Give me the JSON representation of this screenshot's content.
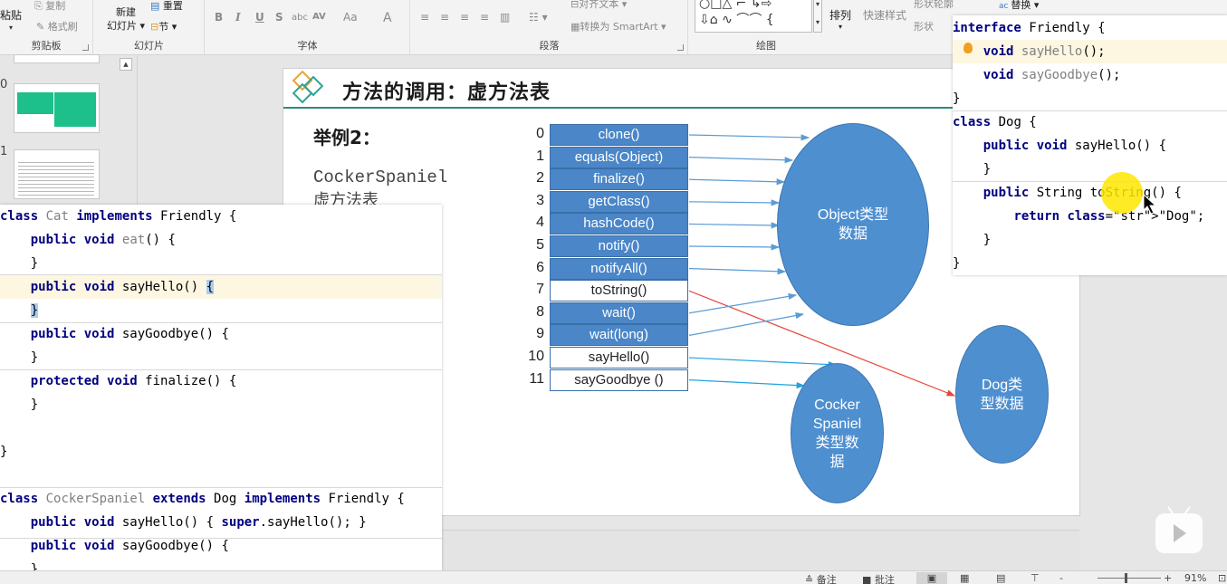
{
  "ribbon": {
    "clipboard": {
      "paste": "粘贴",
      "copy": "复制",
      "format_painter": "格式刷",
      "label": "剪贴板"
    },
    "slides": {
      "new_slide": "新建",
      "new_slide2": "幻灯片",
      "reset": "重置",
      "section": "节",
      "label": "幻灯片"
    },
    "font": {
      "label": "字体",
      "bold": "B",
      "italic": "I",
      "underline": "U",
      "shadow": "S",
      "strike": "abc",
      "spacing": "AV",
      "case": "Aa",
      "color": "A"
    },
    "paragraph": {
      "label": "段落",
      "align_text": "对齐文本",
      "smartart": "转换为 SmartArt"
    },
    "drawing": {
      "label": "绘图",
      "arrange": "排列",
      "quick_styles": "快速样式",
      "shape_outline": "形状轮廓",
      "shape_effects": "形状"
    },
    "editing": {
      "replace": "替换"
    }
  },
  "thumbnails": [
    {
      "number": "0"
    },
    {
      "number": "1"
    }
  ],
  "slide": {
    "title": "方法的调用：虚方法表",
    "example_heading": "举例2：",
    "subtitle_line1": "CockerSpaniel",
    "subtitle_line2": "虚方法表",
    "vtable": [
      {
        "index": "0",
        "method": "clone()",
        "owner": "object"
      },
      {
        "index": "1",
        "method": "equals(Object)",
        "owner": "object"
      },
      {
        "index": "2",
        "method": "finalize()",
        "owner": "object"
      },
      {
        "index": "3",
        "method": "getClass()",
        "owner": "object"
      },
      {
        "index": "4",
        "method": "hashCode()",
        "owner": "object"
      },
      {
        "index": "5",
        "method": "notify()",
        "owner": "object"
      },
      {
        "index": "6",
        "method": "notifyAll()",
        "owner": "object"
      },
      {
        "index": "7",
        "method": "toString()",
        "owner": "dog"
      },
      {
        "index": "8",
        "method": "wait()",
        "owner": "object"
      },
      {
        "index": "9",
        "method": "wait(long)",
        "owner": "object"
      },
      {
        "index": "10",
        "method": "sayHello()",
        "owner": "cocker"
      },
      {
        "index": "11",
        "method": "sayGoodbye ()",
        "owner": "cocker"
      }
    ],
    "object_data": "Object类型\n数据",
    "cocker_data": "Cocker\nSpaniel\n类型数\n据",
    "dog_data": "Dog类\n型数据",
    "colors": {
      "object_fill": "#4a86c8",
      "arrow_blue": "#5b9bd5",
      "arrow_cyan": "#1fa3e0",
      "arrow_red": "#e8443a",
      "title_line": "#2e8b7a"
    }
  },
  "code_left": {
    "lines": [
      "class Cat implements Friendly {",
      "    public void eat() {",
      "    }",
      "    public void sayHello() {",
      "    }",
      "    public void sayGoodbye() {",
      "    }",
      "    protected void finalize() {",
      "    }",
      "",
      "}",
      "",
      "class CockerSpaniel extends Dog implements Friendly {",
      "    public void sayHello() { super.sayHello(); }",
      "    public void sayGoodbye() {",
      "    }"
    ]
  },
  "code_right": {
    "lines": [
      "interface Friendly {",
      "    void sayHello();",
      "    void sayGoodbye();",
      "}",
      "class Dog {",
      "    public void sayHello() {",
      "    }",
      "    public String toString() {",
      "        return \"Dog\";",
      "    }",
      "}"
    ]
  },
  "statusbar": {
    "notes": "≙ 备注",
    "comments": "批注",
    "zoom": "91%",
    "zoom_minus": "-",
    "zoom_plus": "+",
    "zoom_fraction": 0.43
  }
}
